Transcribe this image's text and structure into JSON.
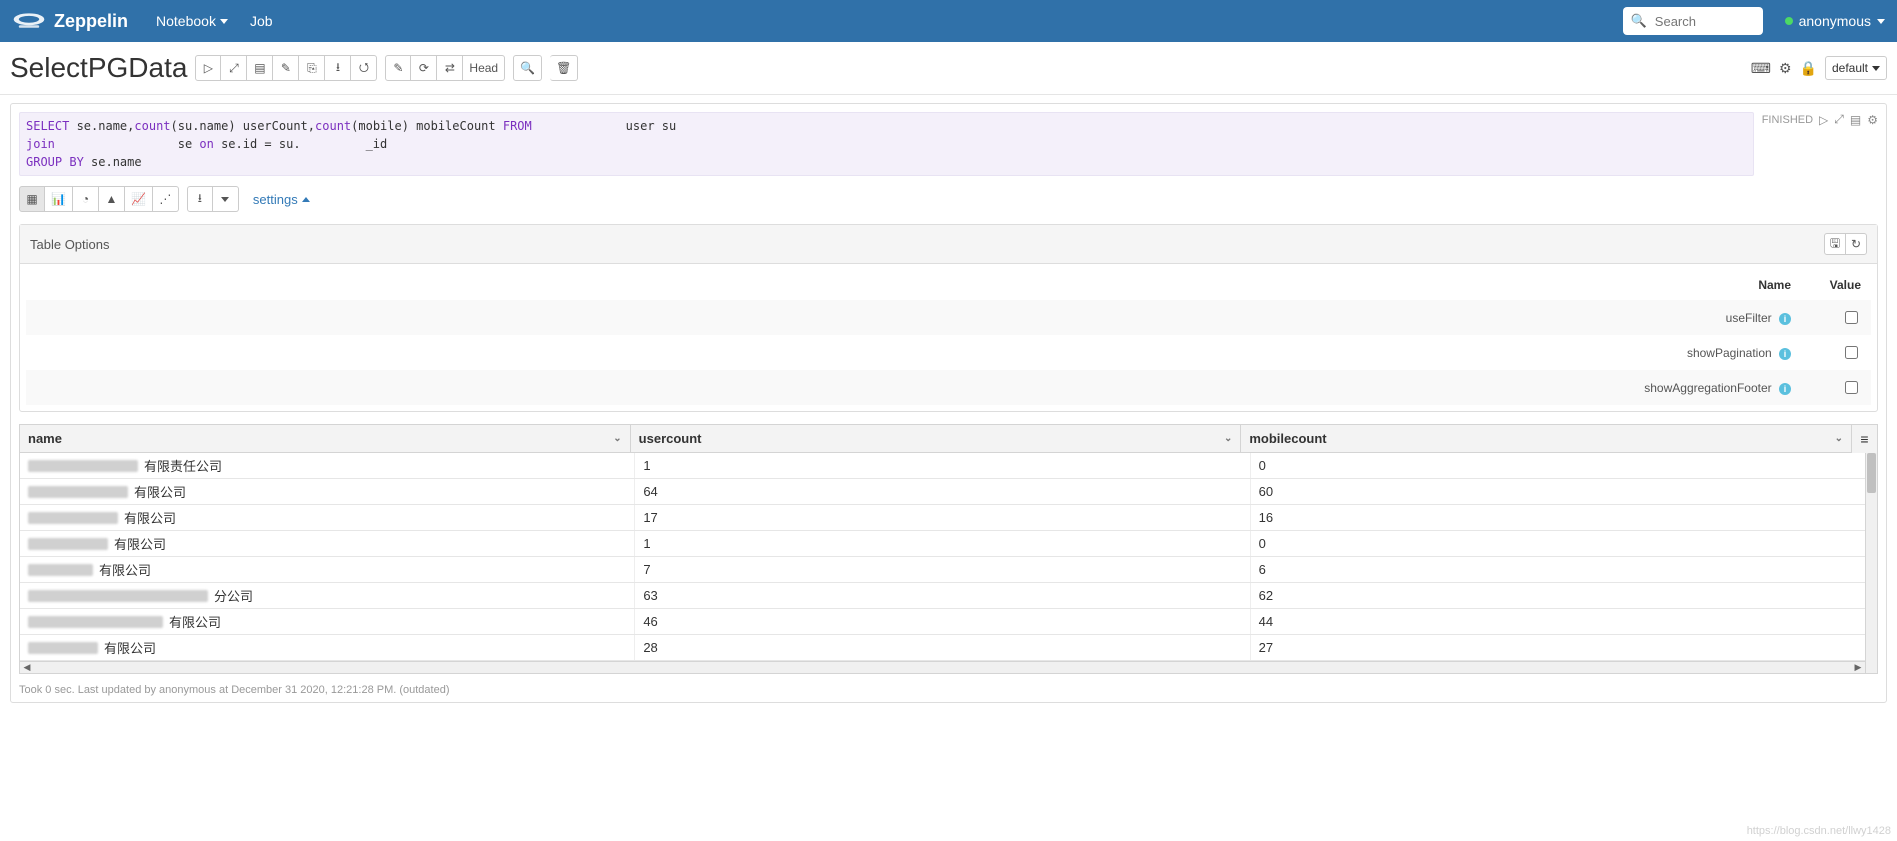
{
  "navbar": {
    "brand": "Zeppelin",
    "notebook": "Notebook",
    "job": "Job",
    "search_placeholder": "Search",
    "user": "anonymous"
  },
  "titlebar": {
    "title": "SelectPGData",
    "head_label": "Head",
    "interpreter_label": "default"
  },
  "paragraph": {
    "code_l1a": "SELECT",
    "code_l1b": " se.name,",
    "code_l1c": "count",
    "code_l1d": "(su.name) userCount,",
    "code_l1e": "count",
    "code_l1f": "(mobile) mobileCount ",
    "code_l1g": "FROM",
    "code_l1h": "             user su",
    "code_l2a": "join",
    "code_l2b": "                 se ",
    "code_l2c": "on",
    "code_l2d": " se.id = su.         _id",
    "code_l3a": "GROUP BY",
    "code_l3b": " se.name",
    "status": "FINISHED",
    "settings_label": "settings"
  },
  "options_panel": {
    "title": "Table Options",
    "col_name": "Name",
    "col_value": "Value",
    "rows": [
      {
        "name": "useFilter"
      },
      {
        "name": "showPagination"
      },
      {
        "name": "showAggregationFooter"
      }
    ]
  },
  "grid": {
    "columns": [
      "name",
      "usercount",
      "mobilecount"
    ],
    "rows": [
      {
        "name_suffix": "有限责任公司",
        "blur_w": 110,
        "usercount": "1",
        "mobilecount": "0"
      },
      {
        "name_suffix": "有限公司",
        "blur_w": 100,
        "usercount": "64",
        "mobilecount": "60"
      },
      {
        "name_suffix": "有限公司",
        "blur_w": 90,
        "usercount": "17",
        "mobilecount": "16"
      },
      {
        "name_suffix": "有限公司",
        "blur_w": 80,
        "usercount": "1",
        "mobilecount": "0"
      },
      {
        "name_suffix": "有限公司",
        "blur_w": 65,
        "usercount": "7",
        "mobilecount": "6"
      },
      {
        "name_suffix": "分公司",
        "blur_w": 180,
        "usercount": "63",
        "mobilecount": "62"
      },
      {
        "name_suffix": "有限公司",
        "blur_w": 135,
        "usercount": "46",
        "mobilecount": "44"
      },
      {
        "name_suffix": "有限公司",
        "blur_w": 70,
        "usercount": "28",
        "mobilecount": "27"
      }
    ]
  },
  "footer": "Took 0 sec. Last updated by anonymous at December 31 2020, 12:21:28 PM. (outdated)",
  "watermark": "https://blog.csdn.net/llwy1428"
}
